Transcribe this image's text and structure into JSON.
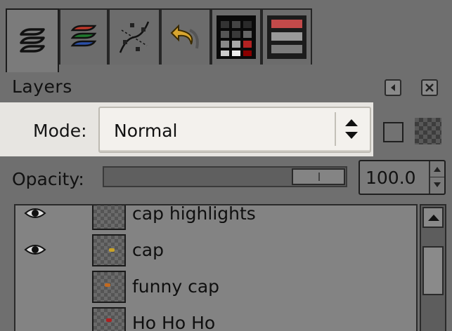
{
  "dock": {
    "tabs": [
      {
        "icon": "layers-icon",
        "active": true
      },
      {
        "icon": "channels-icon",
        "active": false
      },
      {
        "icon": "paths-icon",
        "active": false
      },
      {
        "icon": "undo-history-icon",
        "active": false
      },
      {
        "icon": "colormap-icon",
        "active": false
      },
      {
        "icon": "histogram-icon",
        "active": false
      }
    ]
  },
  "panel": {
    "title": "Layers",
    "header_buttons": [
      "configure-tab-icon",
      "close-tab-icon"
    ]
  },
  "mode": {
    "label": "Mode:",
    "value": "Normal"
  },
  "opacity": {
    "label": "Opacity:",
    "value": "100.0",
    "fraction": 1.0
  },
  "layers": [
    {
      "name": "cap highlights",
      "visible": true
    },
    {
      "name": "cap",
      "visible": true
    },
    {
      "name": "funny cap",
      "visible": false
    },
    {
      "name": "Ho Ho Ho",
      "visible": false
    }
  ],
  "colors": {
    "dock_bg": "#6f6f6f",
    "highlight_row": "#e7e5e1",
    "list_bg": "#838383"
  }
}
